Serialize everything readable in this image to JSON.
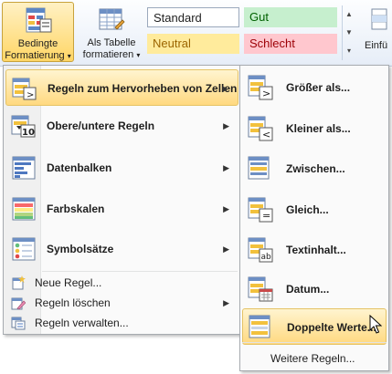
{
  "ribbon": {
    "bedingte_line1": "Bedingte",
    "bedingte_line2": "Formatierung",
    "als_tabelle_line1": "Als Tabelle",
    "als_tabelle_line2": "formatieren",
    "dropdown_glyph": "▾",
    "styles": {
      "standard": "Standard",
      "gut": "Gut",
      "neutral": "Neutral",
      "schlecht": "Schlecht"
    },
    "einfuegen": "Einfü"
  },
  "menu": {
    "items": [
      {
        "label": "Regeln zum Hervorheben von Zellen",
        "icon": "highlight-rules-icon"
      },
      {
        "label": "Obere/untere Regeln",
        "icon": "top-bottom-rules-icon"
      },
      {
        "label": "Datenbalken",
        "icon": "data-bars-icon"
      },
      {
        "label": "Farbskalen",
        "icon": "color-scales-icon"
      },
      {
        "label": "Symbolsätze",
        "icon": "icon-sets-icon"
      }
    ],
    "small_items": [
      {
        "label": "Neue Regel...",
        "icon": "new-rule-icon"
      },
      {
        "label": "Regeln löschen",
        "icon": "clear-rules-icon"
      },
      {
        "label": "Regeln verwalten...",
        "icon": "manage-rules-icon"
      }
    ],
    "arrow": "▶"
  },
  "submenu": {
    "items": [
      {
        "label": "Größer als...",
        "icon": "greater-than-icon"
      },
      {
        "label": "Kleiner als...",
        "icon": "less-than-icon"
      },
      {
        "label": "Zwischen...",
        "icon": "between-icon"
      },
      {
        "label": "Gleich...",
        "icon": "equal-to-icon"
      },
      {
        "label": "Textinhalt...",
        "icon": "text-contains-icon"
      },
      {
        "label": "Datum...",
        "icon": "date-occurring-icon"
      },
      {
        "label": "Doppelte Werte...",
        "icon": "duplicate-values-icon"
      }
    ],
    "more": "Weitere Regeln..."
  },
  "colors": {
    "highlight": "#ffd980",
    "gut_bg": "#c6efce",
    "neutral_bg": "#ffeb9c",
    "schlecht_bg": "#ffc7ce"
  }
}
